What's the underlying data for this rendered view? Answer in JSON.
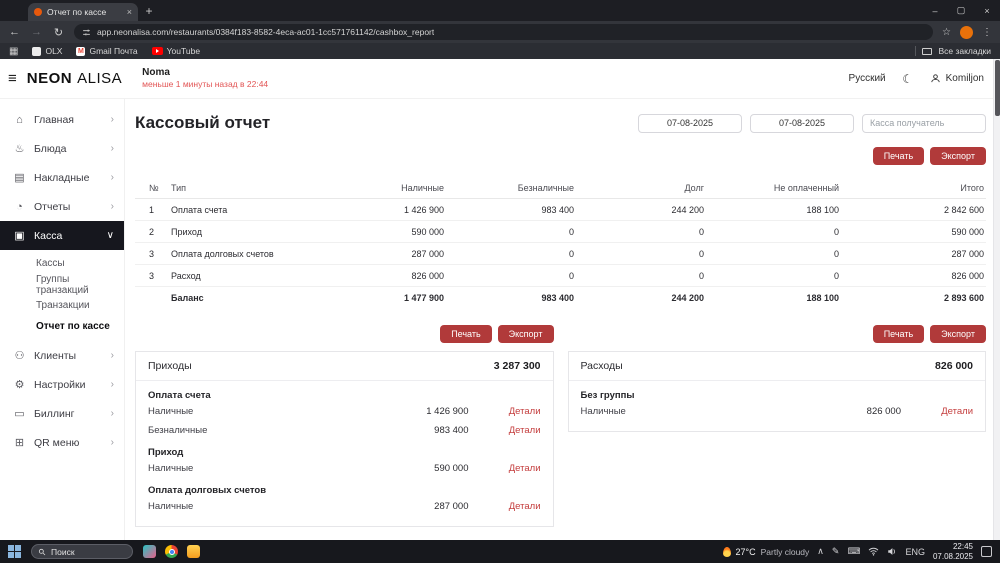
{
  "browser": {
    "tab": {
      "title": "Отчет по кассе"
    },
    "url": "app.neonalisa.com/restaurants/0384f183-8582-4eca-ac01-1cc571761142/cashbox_report",
    "bookmarks_bar": {
      "items": [
        {
          "label": "OLX"
        },
        {
          "label": "Gmail Почта"
        },
        {
          "label": "YouTube"
        }
      ],
      "all_bookmarks": "Все закладки"
    }
  },
  "app_header": {
    "logo_primary": "NEON",
    "logo_secondary": "ALISA",
    "restaurant_name": "Noma",
    "last_sync": "меньше 1 минуты назад в 22:44",
    "language_button": "Русский",
    "user_name": "Komiljon"
  },
  "sidebar": {
    "items": [
      {
        "label": "Главная",
        "icon": "⌂"
      },
      {
        "label": "Блюда",
        "icon": "♨"
      },
      {
        "label": "Накладные",
        "icon": "▤"
      },
      {
        "label": "Отчеты",
        "icon": "◔"
      },
      {
        "label": "Касса",
        "icon": "▣"
      },
      {
        "label": "Клиенты",
        "icon": "⚇"
      },
      {
        "label": "Настройки",
        "icon": "⚙"
      },
      {
        "label": "Биллинг",
        "icon": "▭"
      },
      {
        "label": "QR меню",
        "icon": "⊞"
      }
    ],
    "cash_submenu": [
      "Кассы",
      "Группы транзакций",
      "Транзакции",
      "Отчет по кассе"
    ],
    "active_item": "Касса",
    "active_subitem": "Отчет по кассе"
  },
  "main": {
    "title": "Кассовый отчет",
    "filters": {
      "date_from": "07-08-2025",
      "date_to": "07-08-2025",
      "cashbox_select": "Касса получатель"
    },
    "buttons": {
      "print": "Печать",
      "export": "Экспорт"
    },
    "report_table": {
      "headers": [
        "№",
        "Тип",
        "Наличные",
        "Безналичные",
        "Долг",
        "Не оплаченный",
        "Итого"
      ],
      "rows": [
        [
          "1",
          "Оплата счета",
          "1 426 900",
          "983 400",
          "244 200",
          "188 100",
          "2 842 600"
        ],
        [
          "2",
          "Приход",
          "590 000",
          "0",
          "0",
          "0",
          "590 000"
        ],
        [
          "3",
          "Оплата долговых счетов",
          "287 000",
          "0",
          "0",
          "0",
          "287 000"
        ],
        [
          "3",
          "Расход",
          "826 000",
          "0",
          "0",
          "0",
          "826 000"
        ]
      ],
      "balance_row": [
        "",
        "Баланс",
        "1 477 900",
        "983 400",
        "244 200",
        "188 100",
        "2 893 600"
      ]
    },
    "incomes_panel": {
      "title": "Приходы",
      "total": "3 287 300",
      "details_label": "Детали",
      "groups": [
        {
          "name": "Оплата счета",
          "rows": [
            {
              "label": "Наличные",
              "value": "1 426 900"
            },
            {
              "label": "Безналичные",
              "value": "983 400"
            }
          ]
        },
        {
          "name": "Приход",
          "rows": [
            {
              "label": "Наличные",
              "value": "590 000"
            }
          ]
        },
        {
          "name": "Оплата долговых счетов",
          "rows": [
            {
              "label": "Наличные",
              "value": "287 000"
            }
          ]
        }
      ]
    },
    "expenses_panel": {
      "title": "Расходы",
      "total": "826 000",
      "details_label": "Детали",
      "groups": [
        {
          "name": "Без группы",
          "rows": [
            {
              "label": "Наличные",
              "value": "826 000"
            }
          ]
        }
      ]
    }
  },
  "taskbar": {
    "search_placeholder": "Поиск",
    "weather_temp": "27°C",
    "weather_desc": "Partly cloudy",
    "language": "ENG",
    "time": "22:45",
    "date": "07.08.2025"
  },
  "icons": {
    "back": "←",
    "forward": "→",
    "refresh": "↻",
    "star": "☆",
    "menu_dots": "⋮",
    "close": "×",
    "plus": "+",
    "minimize": "–",
    "maximize": "▢",
    "apps_grid": "▦",
    "hamburger": "≡",
    "moon": "☾",
    "chevron_right": "›",
    "chevron_down": "∨",
    "chevron_up": "∧",
    "pen": "✎",
    "keyboard": "⌨",
    "gmail_letter": "M"
  },
  "colors": {
    "accent_red": "#b13a3a",
    "link_red": "#c43d3d",
    "sync_red": "#e25555",
    "sidebar_active_bg": "#16171e"
  }
}
